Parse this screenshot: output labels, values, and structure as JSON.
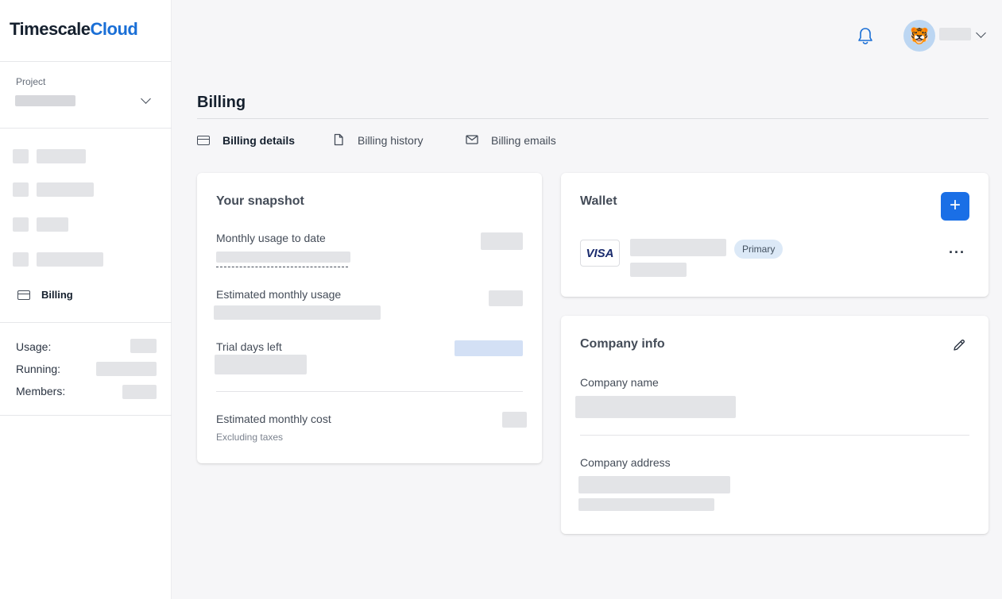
{
  "app": {
    "brand_a": "Timescale",
    "brand_b": "Cloud",
    "accent": "#1a6fe6"
  },
  "sidebar": {
    "project_label": "Project",
    "active_item": {
      "label": "Billing",
      "icon": "credit-card-icon"
    },
    "stats": [
      {
        "label": "Usage:"
      },
      {
        "label": "Running:"
      },
      {
        "label": "Members:"
      }
    ]
  },
  "header": {
    "icons": [
      "bell-icon",
      "avatar",
      "chevron-down-icon"
    ]
  },
  "page": {
    "title": "Billing",
    "tabs": [
      {
        "label": "Billing details",
        "icon": "credit-card-icon",
        "active": true
      },
      {
        "label": "Billing history",
        "icon": "document-icon",
        "active": false
      },
      {
        "label": "Billing emails",
        "icon": "envelope-icon",
        "active": false
      }
    ]
  },
  "snapshot": {
    "title": "Your snapshot",
    "rows": [
      {
        "label": "Monthly usage to date"
      },
      {
        "label": "Estimated monthly usage"
      },
      {
        "label": "Trial days left"
      }
    ],
    "cost": {
      "label": "Estimated monthly cost",
      "sublabel": "Excluding taxes"
    }
  },
  "wallet": {
    "title": "Wallet",
    "add_label": "+",
    "card": {
      "brand": "VISA",
      "badge": "Primary",
      "more": "···"
    }
  },
  "company": {
    "title": "Company info",
    "name_label": "Company name",
    "address_label": "Company address"
  }
}
